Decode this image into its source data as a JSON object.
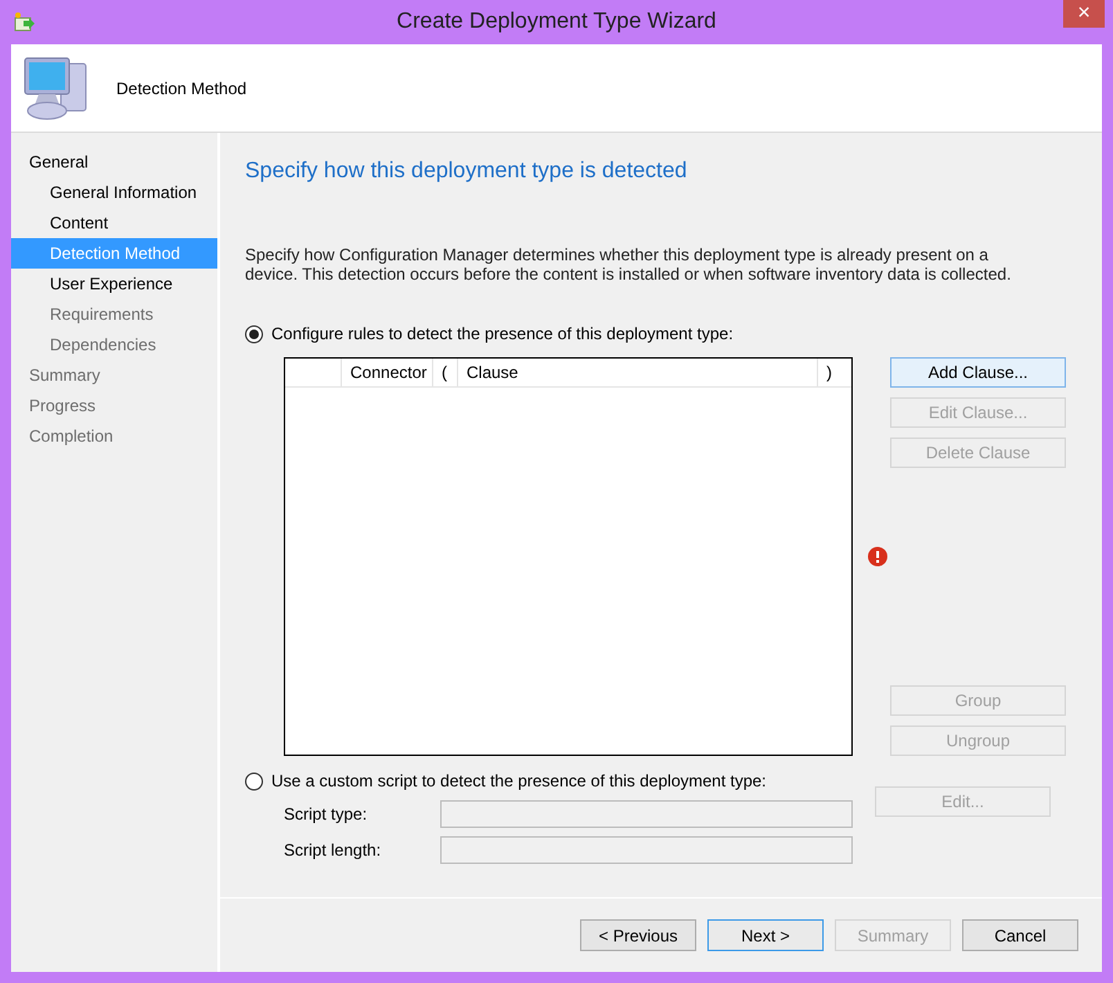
{
  "window": {
    "title": "Create Deployment Type Wizard",
    "close": "×"
  },
  "header": {
    "title": "Detection Method"
  },
  "nav": [
    {
      "label": "General",
      "selected": false,
      "disabled": false,
      "children": [
        {
          "label": "General Information",
          "selected": false,
          "disabled": false
        },
        {
          "label": "Content",
          "selected": false,
          "disabled": false
        },
        {
          "label": "Detection Method",
          "selected": true,
          "disabled": false
        },
        {
          "label": "User Experience",
          "selected": false,
          "disabled": false
        },
        {
          "label": "Requirements",
          "selected": false,
          "disabled": true
        },
        {
          "label": "Dependencies",
          "selected": false,
          "disabled": true
        }
      ]
    },
    {
      "label": "Summary",
      "selected": false,
      "disabled": true
    },
    {
      "label": "Progress",
      "selected": false,
      "disabled": true
    },
    {
      "label": "Completion",
      "selected": false,
      "disabled": true
    }
  ],
  "heading": "Specify how this deployment type is detected",
  "description": "Specify how Configuration Manager determines whether this deployment type is already present on a device. This detection occurs before the content is installed or when software inventory data is collected.",
  "rules_option": {
    "label": "Configure rules to detect the presence of this deployment type:",
    "selected": true
  },
  "table": {
    "columns": [
      "Connector",
      "(",
      "Clause",
      ")"
    ]
  },
  "clause_buttons": [
    {
      "label": "Add Clause...",
      "disabled": false
    },
    {
      "label": "Edit Clause...",
      "disabled": true
    },
    {
      "label": "Delete Clause",
      "disabled": true
    }
  ],
  "group_buttons": [
    {
      "label": "Group",
      "disabled": true
    },
    {
      "label": "Ungroup",
      "disabled": true
    }
  ],
  "script_option": {
    "label": "Use a custom script to detect the presence of this deployment type:",
    "selected": false
  },
  "script_fields": [
    {
      "label": "Script type:",
      "disabled": true
    },
    {
      "label": "Script length:",
      "disabled": true
    }
  ],
  "edit_button": {
    "label": "Edit...",
    "disabled": true
  },
  "footer_buttons": [
    {
      "label": "< Previous",
      "disabled": false,
      "default": false
    },
    {
      "label": "Next >",
      "disabled": false,
      "default": true
    },
    {
      "label": "Summary",
      "disabled": true,
      "default": false
    },
    {
      "label": "Cancel",
      "disabled": false,
      "default": false
    }
  ]
}
